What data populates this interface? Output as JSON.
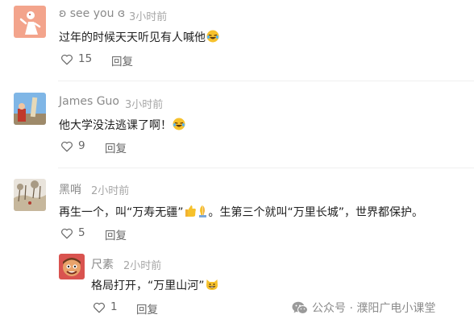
{
  "comments": [
    {
      "name": "ʚ see you ɞ",
      "time": "3小时前",
      "text": "过年的时候天天听见有人喊他",
      "emoji": "laugh-tears-icon",
      "likes": "15",
      "reply_label": "回复"
    },
    {
      "name": "James Guo",
      "time": "3小时前",
      "text": "他大学没法逃课了啊！",
      "emoji": "laugh-tears-icon",
      "likes": "9",
      "reply_label": "回复"
    },
    {
      "name": "黑哨",
      "time": "2小时前",
      "text_a": "再生一个，叫“万寿无疆”",
      "text_b": "。生第三个就叫“万里长城”，世界都保护。",
      "emoji": "thumbs-up-pray-icon",
      "likes": "5",
      "reply_label": "回复"
    }
  ],
  "reply": {
    "name": "尺素",
    "time": "2小时前",
    "text": "格局打开，“万里山河”",
    "emoji": "cat-grin-icon",
    "likes": "1",
    "reply_label": "回复"
  },
  "watermark": {
    "text": "公众号 · 濮阳广电小课堂",
    "icon": "wechat-icon"
  },
  "colors": {
    "name": "#8a8a8a",
    "time": "#a6a6a6",
    "text": "#1f1f1f",
    "action": "#666666"
  }
}
